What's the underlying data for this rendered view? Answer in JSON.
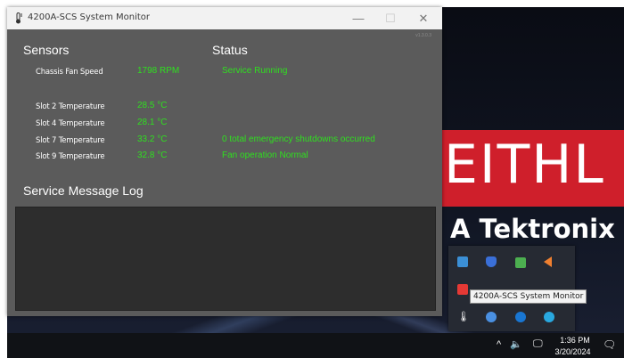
{
  "window": {
    "title": "4200A-SCS System Monitor",
    "version": "v1.3.0.3",
    "controls": {
      "minimize": "—",
      "maximize": "☐",
      "close": "✕"
    }
  },
  "sensors": {
    "heading": "Sensors",
    "rows": [
      {
        "label": "Chassis Fan Speed",
        "value": "1798 RPM"
      },
      {
        "label": "Slot 2 Temperature",
        "value": "28.5 °C"
      },
      {
        "label": "Slot 4 Temperature",
        "value": "28.1 °C"
      },
      {
        "label": "Slot 7 Temperature",
        "value": "33.2 °C"
      },
      {
        "label": "Slot 9 Temperature",
        "value": "32.8 °C"
      }
    ]
  },
  "status": {
    "heading": "Status",
    "lines": [
      "Service Running",
      "0 total emergency shutdowns occurred",
      "Fan operation Normal"
    ]
  },
  "log": {
    "heading": "Service Message Log"
  },
  "desktop": {
    "brand": "EITHL",
    "brand_sub": "A Tektronix C"
  },
  "tray": {
    "tooltip": "4200A-SCS System Monitor"
  },
  "taskbar": {
    "time": "1:36 PM",
    "date": "3/20/2024"
  },
  "colors": {
    "status_green": "#2fe01f",
    "window_bg": "#5b5b5b",
    "log_bg": "#2d2d2d",
    "brand_red": "#cf1f2b"
  }
}
